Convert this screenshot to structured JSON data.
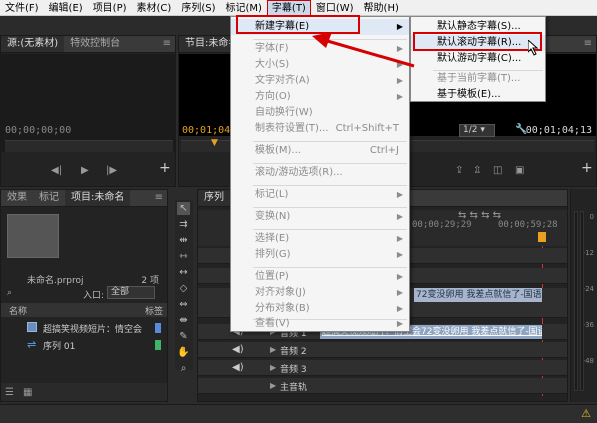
{
  "menubar": {
    "items": [
      "文件(F)",
      "编辑(E)",
      "项目(P)",
      "素材(C)",
      "序列(S)",
      "标记(M)",
      "字幕(T)",
      "窗口(W)",
      "帮助(H)"
    ]
  },
  "source_monitor": {
    "tabs": [
      "源:(无素材)",
      "特效控制台"
    ],
    "timecode_left": "00;00;00;00"
  },
  "program_monitor": {
    "tab": "节目:未命名",
    "timecode_left": "00;01;04;1",
    "zoom": "1/2",
    "timecode_right": "00;01;04;13"
  },
  "project_panel": {
    "tabs": [
      "效果",
      "标记",
      "项目:未命名"
    ],
    "project_file": "未命名.prproj",
    "item_count": "2 项",
    "entry_label": "入口:",
    "entry_value": "全部",
    "col_name": "名称",
    "col_label": "标签",
    "items": [
      "超搞笑视频短片：情空会",
      "序列 01"
    ]
  },
  "timeline": {
    "tab": "序列",
    "ruler_labels": [
      "00;00;29;29",
      "00;00;59;28"
    ],
    "clip_text_1": "72变没卵用 我差点就信了-国语",
    "clip_text_2": "超搞笑视频短片：情空会72变没卵用 我差点就信了-国语",
    "tracks": [
      "音频 1",
      "音频 2",
      "音频 3",
      "主音轨"
    ]
  },
  "title_menu": {
    "items": [
      {
        "label": "新建字幕(E)",
        "submenu": true,
        "enabled": true
      },
      {
        "label": "字体(F)",
        "submenu": true,
        "enabled": false
      },
      {
        "label": "大小(S)",
        "submenu": true,
        "enabled": false
      },
      {
        "label": "文字对齐(A)",
        "submenu": true,
        "enabled": false
      },
      {
        "label": "方向(O)",
        "submenu": true,
        "enabled": false
      },
      {
        "label": "自动换行(W)",
        "enabled": false
      },
      {
        "label": "制表符设置(T)...",
        "shortcut": "Ctrl+Shift+T",
        "enabled": false
      },
      {
        "label": "模板(M)...",
        "shortcut": "Ctrl+J",
        "enabled": false
      },
      {
        "label": "滚动/游动选项(R)...",
        "enabled": false
      },
      {
        "label": "标记(L)",
        "submenu": true,
        "enabled": false
      },
      {
        "label": "变换(N)",
        "submenu": true,
        "enabled": false
      },
      {
        "label": "选择(E)",
        "submenu": true,
        "enabled": false
      },
      {
        "label": "排列(G)",
        "submenu": true,
        "enabled": false
      },
      {
        "label": "位置(P)",
        "submenu": true,
        "enabled": false
      },
      {
        "label": "对齐对象(J)",
        "submenu": true,
        "enabled": false
      },
      {
        "label": "分布对象(B)",
        "submenu": true,
        "enabled": false
      },
      {
        "label": "查看(V)",
        "submenu": true,
        "enabled": false
      }
    ]
  },
  "new_title_submenu": {
    "items": [
      {
        "label": "默认静态字幕(S)...",
        "enabled": true
      },
      {
        "label": "默认滚动字幕(R)...",
        "enabled": true
      },
      {
        "label": "默认游动字幕(C)...",
        "enabled": true
      },
      {
        "label": "基于当前字幕(T)...",
        "enabled": false
      },
      {
        "label": "基于模板(E)...",
        "enabled": true
      }
    ]
  },
  "colors": {
    "accent_red": "#d60000",
    "timecode_orange": "#e8a020",
    "clip_blue": "#8fa9c8"
  }
}
